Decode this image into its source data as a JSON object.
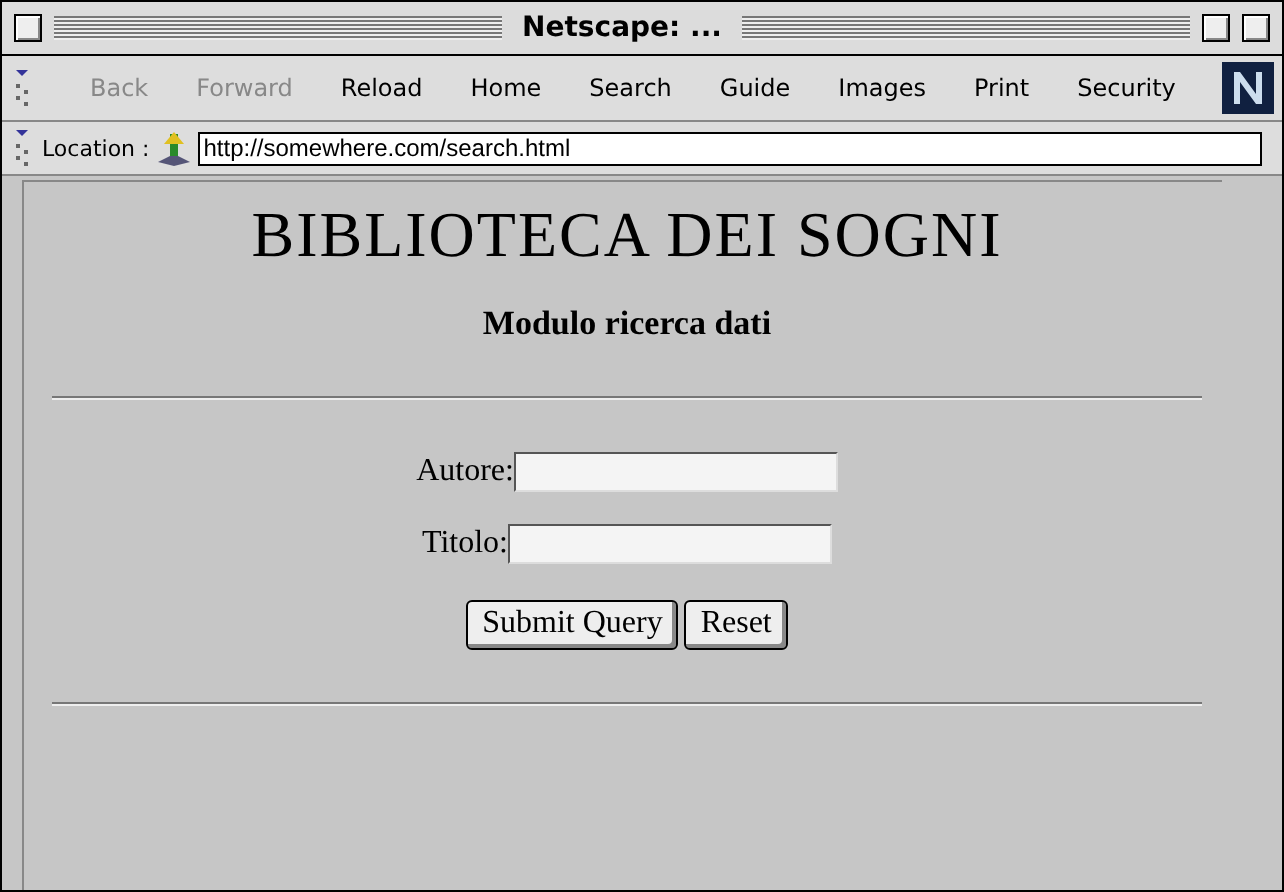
{
  "window": {
    "title": "Netscape: ..."
  },
  "toolbar": [
    {
      "label": "Back",
      "disabled": true
    },
    {
      "label": "Forward",
      "disabled": true
    },
    {
      "label": "Reload",
      "disabled": false
    },
    {
      "label": "Home",
      "disabled": false
    },
    {
      "label": "Search",
      "disabled": false
    },
    {
      "label": "Guide",
      "disabled": false
    },
    {
      "label": "Images",
      "disabled": false
    },
    {
      "label": "Print",
      "disabled": false
    },
    {
      "label": "Security",
      "disabled": false
    }
  ],
  "location": {
    "label": "Location :",
    "value": "http://somewhere.com/search.html"
  },
  "page": {
    "heading": "BIBLIOTECA DEI SOGNI",
    "subheading": "Modulo ricerca dati",
    "fields": [
      {
        "label": "Autore:"
      },
      {
        "label": "Titolo:"
      }
    ],
    "buttons": [
      "Submit Query",
      "Reset"
    ]
  }
}
